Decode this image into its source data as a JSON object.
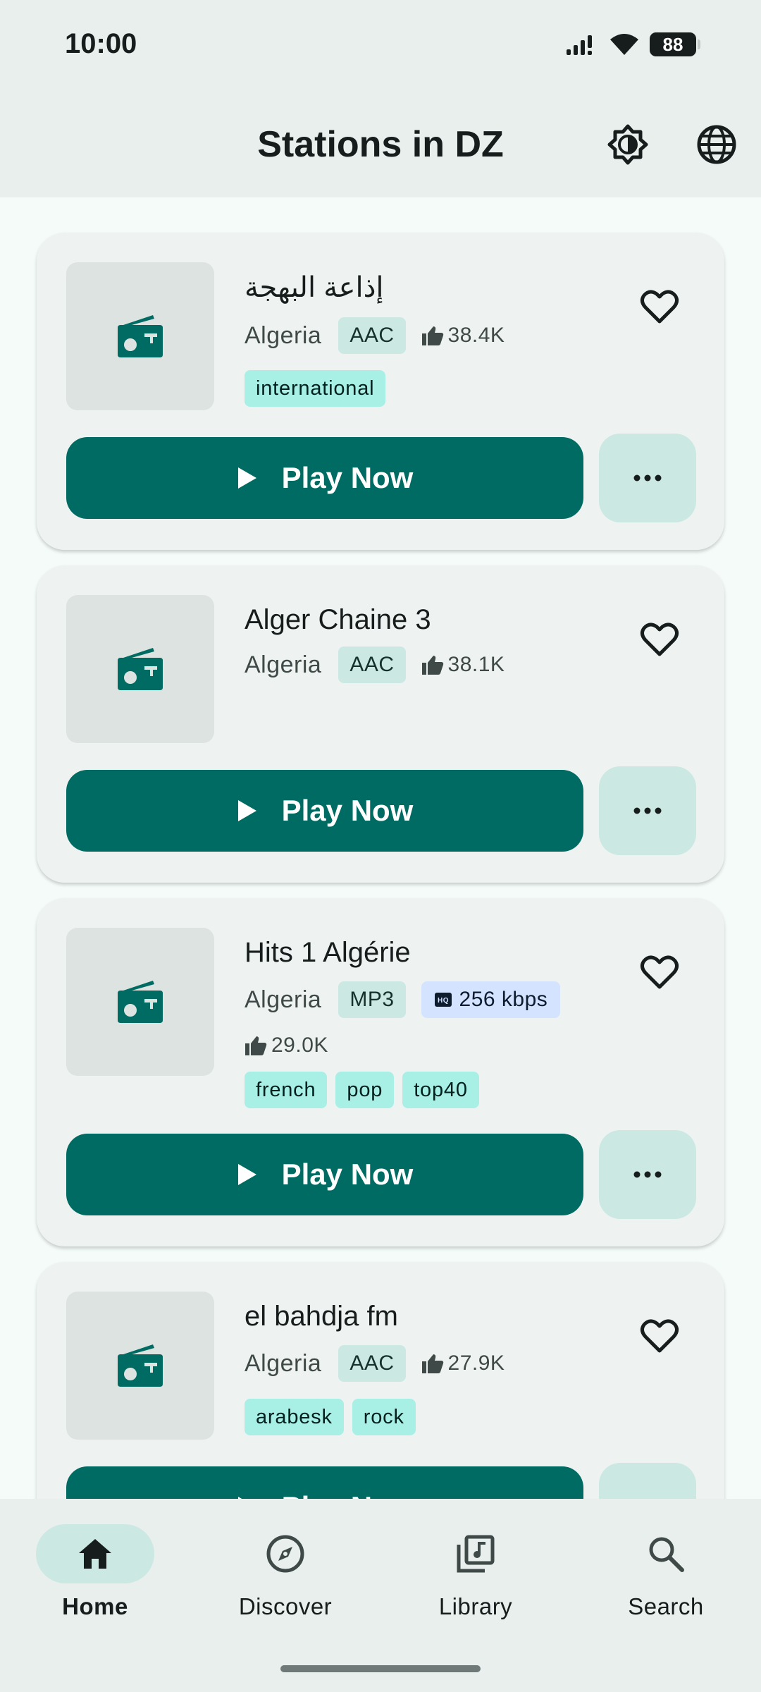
{
  "status_bar": {
    "time": "10:00",
    "battery": "88"
  },
  "header": {
    "title": "Stations in DZ",
    "theme_icon": "brightness-icon",
    "language_icon": "globe-icon"
  },
  "stations": [
    {
      "name": "إذاعة البهجة",
      "country": "Algeria",
      "codec": "AAC",
      "votes": "38.4K",
      "tags": [
        "international"
      ],
      "play_label": "Play Now"
    },
    {
      "name": "Alger Chaine 3",
      "country": "Algeria",
      "codec": "AAC",
      "votes": "38.1K",
      "tags": [],
      "play_label": "Play Now"
    },
    {
      "name": "Hits 1 Algérie",
      "country": "Algeria",
      "codec": "MP3",
      "bitrate": "256 kbps",
      "votes": "29.0K",
      "tags": [
        "french",
        "pop",
        "top40"
      ],
      "play_label": "Play Now"
    },
    {
      "name": "el bahdja fm",
      "country": "Algeria",
      "codec": "AAC",
      "votes": "27.9K",
      "tags": [
        "arabesk",
        "rock"
      ],
      "play_label": "Play Now"
    }
  ],
  "bottom_nav": {
    "items": [
      {
        "label": "Home",
        "icon": "home-icon",
        "active": true
      },
      {
        "label": "Discover",
        "icon": "compass-icon",
        "active": false
      },
      {
        "label": "Library",
        "icon": "library-icon",
        "active": false
      },
      {
        "label": "Search",
        "icon": "search-icon",
        "active": false
      }
    ]
  },
  "colors": {
    "primary": "#006b62",
    "tag_bg": "#a8f0e6",
    "chip_bg": "#cce8e3",
    "bitrate_bg": "#d4e3ff"
  }
}
